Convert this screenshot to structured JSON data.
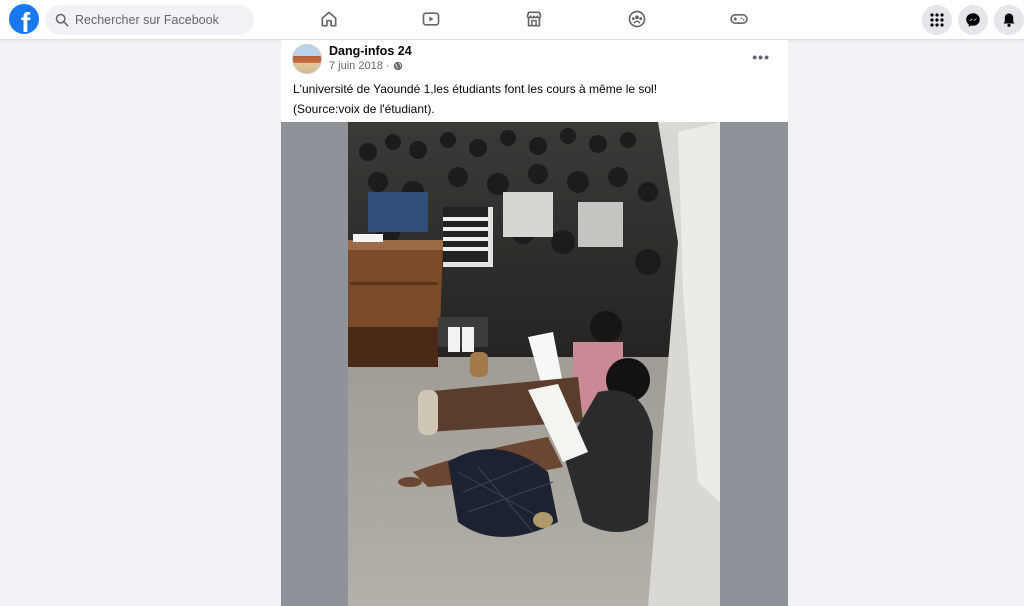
{
  "search": {
    "placeholder": "Rechercher sur Facebook"
  },
  "logo": {
    "letter": "f"
  },
  "nav": {
    "items": [
      {
        "name": "home-icon"
      },
      {
        "name": "watch-icon"
      },
      {
        "name": "marketplace-icon"
      },
      {
        "name": "groups-icon"
      },
      {
        "name": "gaming-icon"
      }
    ]
  },
  "header_actions": [
    {
      "name": "menu-grid-icon"
    },
    {
      "name": "messenger-icon"
    },
    {
      "name": "notifications-bell-icon"
    }
  ],
  "post": {
    "author": "Dang-infos 24",
    "date": "7 juin 2018",
    "separator": "·",
    "audience_icon": "globe-icon",
    "more": "•••",
    "caption_line1": "L'université de Yaoundé 1,les étudiants font les cours à même le sol!",
    "caption_line2": "(Source:voix de l'étudiant)."
  },
  "colors": {
    "brand": "#1877f2",
    "background": "#f0f2f5",
    "secondary_text": "#65676b"
  }
}
